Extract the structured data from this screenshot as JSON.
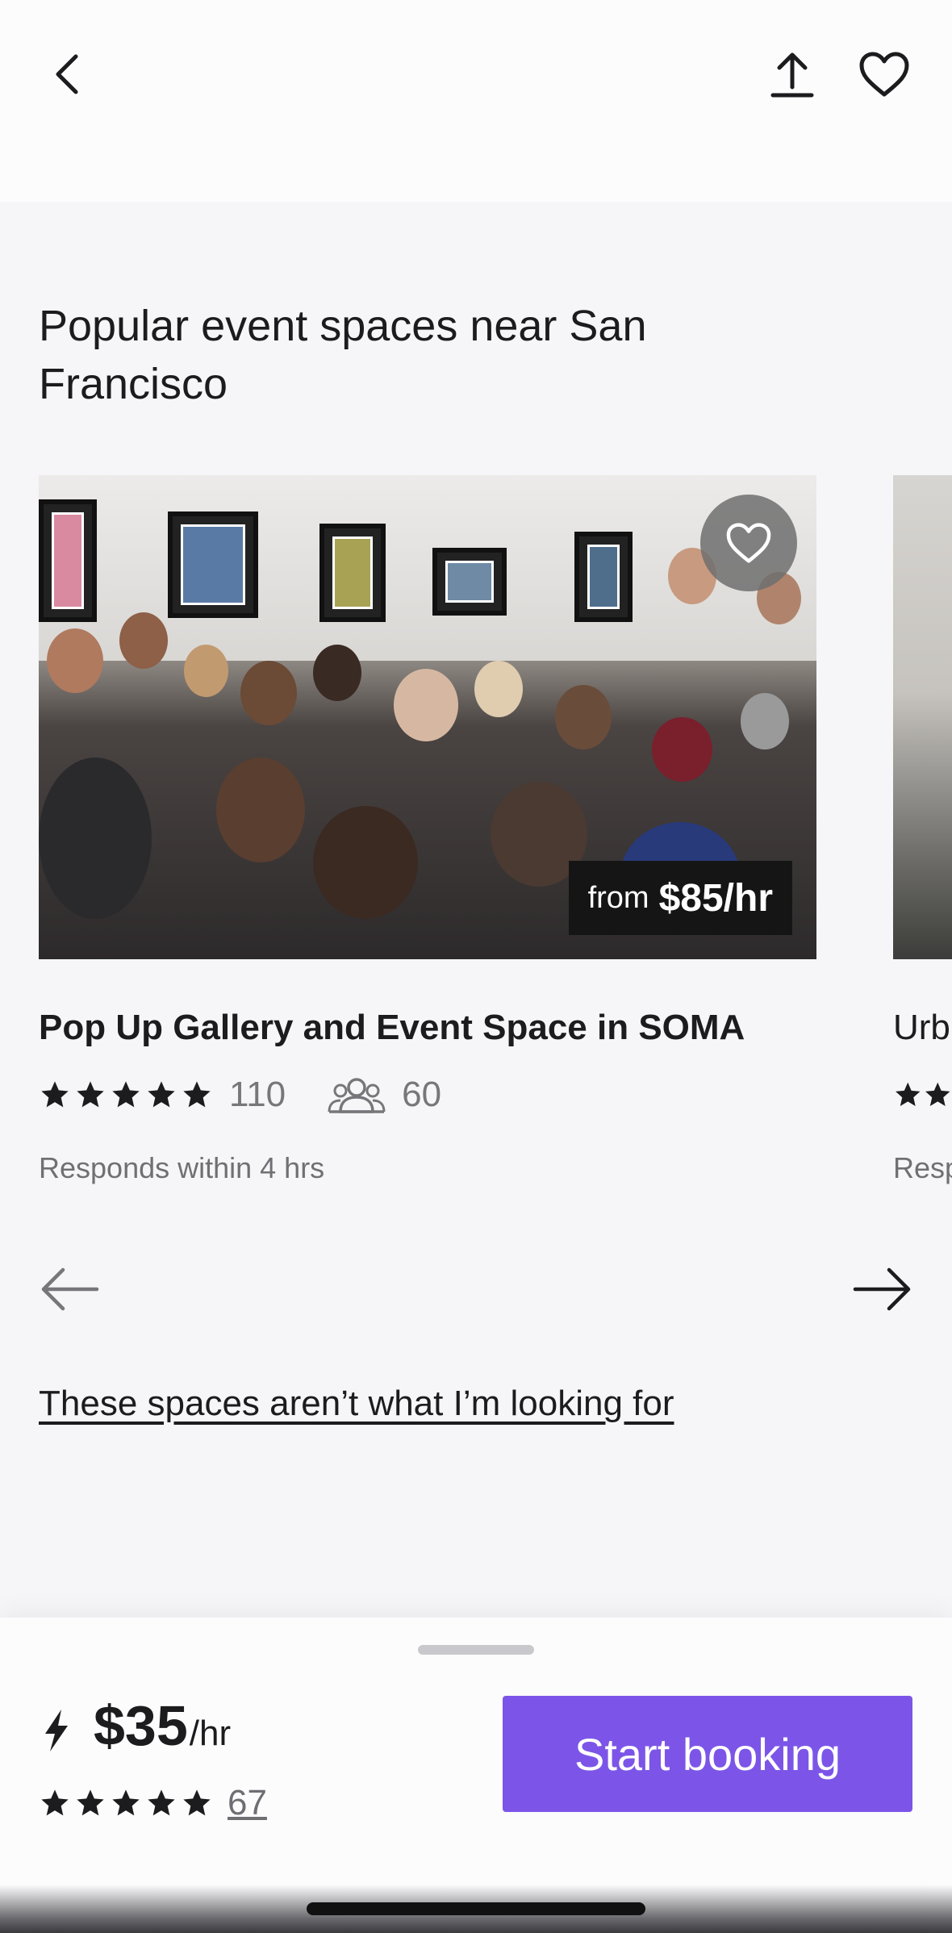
{
  "header": {
    "back_icon": "chevron-left-icon",
    "share_icon": "share-upload-icon",
    "favorite_icon": "heart-outline-icon"
  },
  "section": {
    "title": "Popular event spaces near San Francisco"
  },
  "card": {
    "image": "gallery-event-photo",
    "price_prefix": "from",
    "price": "$85/hr",
    "title": "Pop Up Gallery and Event Space in SOMA",
    "rating_stars": 5,
    "reviews": "110",
    "capacity": "60",
    "response": "Responds within 4 hrs"
  },
  "peek_card": {
    "title": "Urb",
    "response": "Resp"
  },
  "carousel": {
    "prev_icon": "arrow-left-icon",
    "next_icon": "arrow-right-icon"
  },
  "not_looking_link": "These spaces aren’t what I’m looking for",
  "booking": {
    "instant_icon": "lightning-bolt-icon",
    "price": "$35",
    "unit": "/hr",
    "rating_stars": 5,
    "reviews": "67",
    "button_label": "Start booking",
    "button_color": "#7c55e8"
  }
}
